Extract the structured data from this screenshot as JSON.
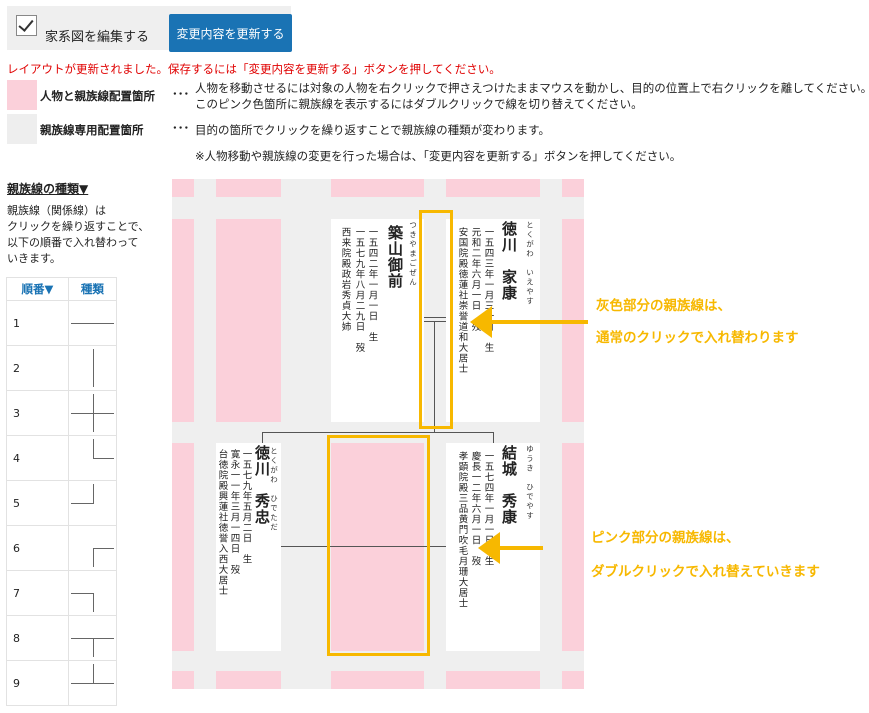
{
  "toolbar": {
    "edit_checkbox_label": "家系図を編集する",
    "update_button_label": "変更内容を更新する"
  },
  "notice": "レイアウトが更新されました。保存するには「変更内容を更新する」ボタンを押してください。",
  "legend": {
    "pink": {
      "title": "人物と親族線配置箇所",
      "dots": "･･･",
      "line1": "人物を移動させるには対象の人物を右クリックで押さえつけたままマウスを動かし、目的の位置上で右クリックを離してください。",
      "line2": "このピンク色箇所に親族線を表示するにはダブルクリックで線を切り替えてください。"
    },
    "gray": {
      "title": "親族線専用配置箇所",
      "dots": "･･･",
      "line1": "目的の箇所でクリックを繰り返すことで親族線の種類が変わります。"
    },
    "footnote": "※人物移動や親族線の変更を行った場合は、「変更内容を更新する」ボタンを押してください。"
  },
  "sidebar": {
    "title": "親族線の種類▼",
    "desc": [
      "親族線（関係線）は",
      "クリックを繰り返すことで、",
      "以下の順番で入れ替わって",
      "いきます。"
    ],
    "col_order": "順番▼",
    "col_type": "種類",
    "rows": [
      {
        "num": "1",
        "icon": "horizontal-line-icon"
      },
      {
        "num": "2",
        "icon": "vertical-line-icon"
      },
      {
        "num": "3",
        "icon": "cross-line-icon"
      },
      {
        "num": "4",
        "icon": "up-right-corner-icon"
      },
      {
        "num": "5",
        "icon": "up-left-corner-icon"
      },
      {
        "num": "6",
        "icon": "down-right-corner-icon"
      },
      {
        "num": "7",
        "icon": "down-left-corner-icon"
      },
      {
        "num": "8",
        "icon": "tee-down-icon"
      },
      {
        "num": "9",
        "icon": "tee-up-icon"
      }
    ]
  },
  "tree": {
    "persons": [
      {
        "kana": "とくがわ　いえやす",
        "name": "徳川　家康",
        "birth": "一五四三年一月三一日　生",
        "death": "元和二年六月一日　歿",
        "posthumous": "安国院殿徳蓮社崇誉道和大居士"
      },
      {
        "kana": "つきやまごぜん",
        "name": "築山御前",
        "birth": "一五四二年一月一日　生",
        "death": "一五七九年八月二九日　歿",
        "posthumous": "西来院殿政岩秀貞大姉"
      },
      {
        "kana": "ゆうき　ひでやす",
        "name": "結城　秀康",
        "birth": "一五七四年一月一日　生",
        "death": "慶長一二年六月一日　歿",
        "posthumous": "孝顕院殿三品黄門吹毛月珊大居士"
      },
      {
        "kana": "とくがわ　ひでただ",
        "name": "徳川　秀忠",
        "birth": "一五七九年五月二日　生",
        "death": "寛永一一年三月一四日　歿",
        "posthumous": "台徳院殿興蓮社徳誉入西大居士"
      }
    ]
  },
  "annotations": {
    "gray_note_1": "灰色部分の親族線は、",
    "gray_note_2": "通常のクリックで入れ替わります",
    "pink_note_1": "ピンク部分の親族線は、",
    "pink_note_2": "ダブルクリックで入れ替えていきます"
  },
  "colors": {
    "pink_area": "#fbd0da",
    "gray_area": "#eeeeee",
    "accent_blue": "#1a73b4",
    "notice_red": "#e00000",
    "annotation_yellow": "#f7b800"
  }
}
